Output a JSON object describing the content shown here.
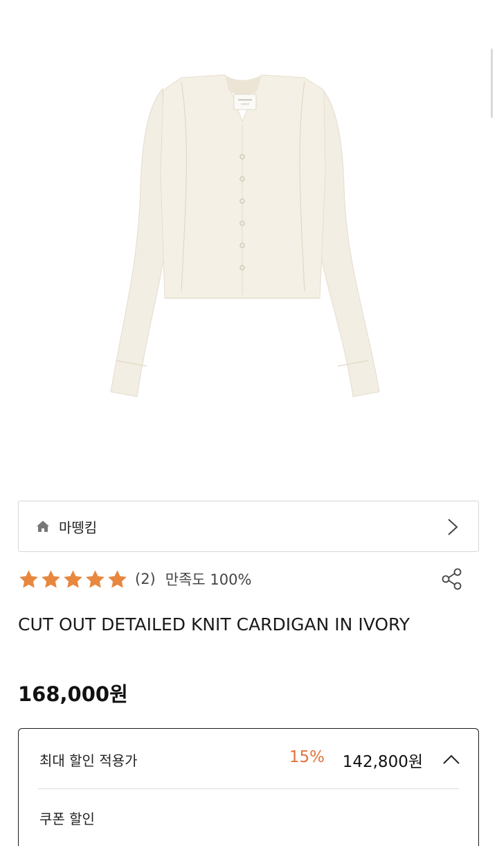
{
  "product_image": {
    "alt": "cardigan-photo"
  },
  "brand": {
    "name": "마뗑킴"
  },
  "rating": {
    "stars": 5,
    "review_count": "(2)",
    "satisfaction": "만족도 100%"
  },
  "product": {
    "title": "CUT OUT DETAILED KNIT CARDIGAN IN IVORY",
    "price": "168,000원"
  },
  "discount": {
    "label": "최대 할인 적용가",
    "rate": "15%",
    "price": "142,800원",
    "coupon_label": "쿠폰 할인"
  },
  "colors": {
    "accent": "#e2733c",
    "star": "#e8873f",
    "cardigan": "#f4efe4"
  }
}
